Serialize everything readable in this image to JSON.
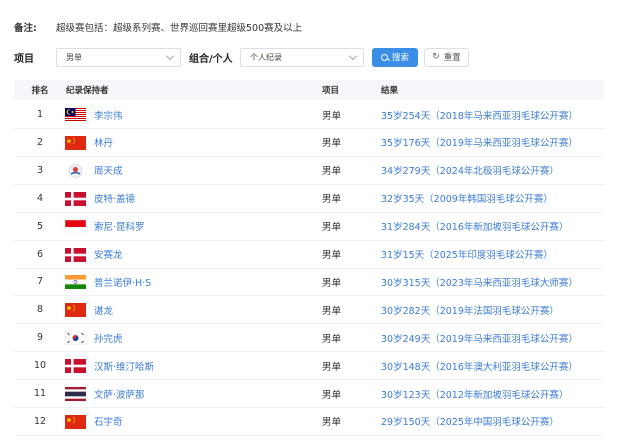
{
  "note": {
    "label": "备注:",
    "text": "超级赛包括：超级系列赛、世界巡回赛里超级500赛及以上"
  },
  "filters": {
    "event_label": "项目",
    "event_value": "男单",
    "group_label": "组合/个人",
    "group_value": "个人纪录",
    "search_label": "搜索",
    "reset_label": "重置"
  },
  "table": {
    "headers": {
      "rank": "排名",
      "holder": "纪录保持者",
      "event": "项目",
      "result": "结果"
    },
    "rows": [
      {
        "rank": "1",
        "flag": "MY",
        "name": "李宗伟",
        "event": "男单",
        "result": "35岁254天（2018年马来西亚羽毛球公开赛）"
      },
      {
        "rank": "2",
        "flag": "CN",
        "name": "林丹",
        "event": "男单",
        "result": "35岁176天（2019年马来西亚羽毛球公开赛）"
      },
      {
        "rank": "3",
        "flag": "TW",
        "name": "周天成",
        "event": "男单",
        "result": "34岁279天（2024年北极羽毛球公开赛）"
      },
      {
        "rank": "4",
        "flag": "DK",
        "name": "皮特·盖德",
        "event": "男单",
        "result": "32岁35天（2009年韩国羽毛球公开赛）"
      },
      {
        "rank": "5",
        "flag": "ID",
        "name": "索尼·昆科罗",
        "event": "男单",
        "result": "31岁284天（2016年新加坡羽毛球公开赛）"
      },
      {
        "rank": "6",
        "flag": "DK",
        "name": "安赛龙",
        "event": "男单",
        "result": "31岁15天（2025年印度羽毛球公开赛）"
      },
      {
        "rank": "7",
        "flag": "IN",
        "name": "普兰诺伊·H·S",
        "event": "男单",
        "result": "30岁315天（2023年马来西亚羽毛球大师赛）"
      },
      {
        "rank": "8",
        "flag": "CN",
        "name": "谌龙",
        "event": "男单",
        "result": "30岁282天（2019年法国羽毛球公开赛）"
      },
      {
        "rank": "9",
        "flag": "KR",
        "name": "孙完虎",
        "event": "男单",
        "result": "30岁249天（2019年马来西亚羽毛球公开赛）"
      },
      {
        "rank": "10",
        "flag": "DK",
        "name": "汉斯·维汀哈斯",
        "event": "男单",
        "result": "30岁148天（2016年澳大利亚羽毛球公开赛）"
      },
      {
        "rank": "11",
        "flag": "TH",
        "name": "文萨·波萨那",
        "event": "男单",
        "result": "30岁123天（2012年新加坡羽毛球公开赛）"
      },
      {
        "rank": "12",
        "flag": "CN",
        "name": "石宇奇",
        "event": "男单",
        "result": "29岁150天（2025年中国羽毛球公开赛）"
      }
    ]
  },
  "colors": {
    "link": "#3a7bd5",
    "primary": "#3a8ee6",
    "header_bg": "#f5f7fa"
  }
}
